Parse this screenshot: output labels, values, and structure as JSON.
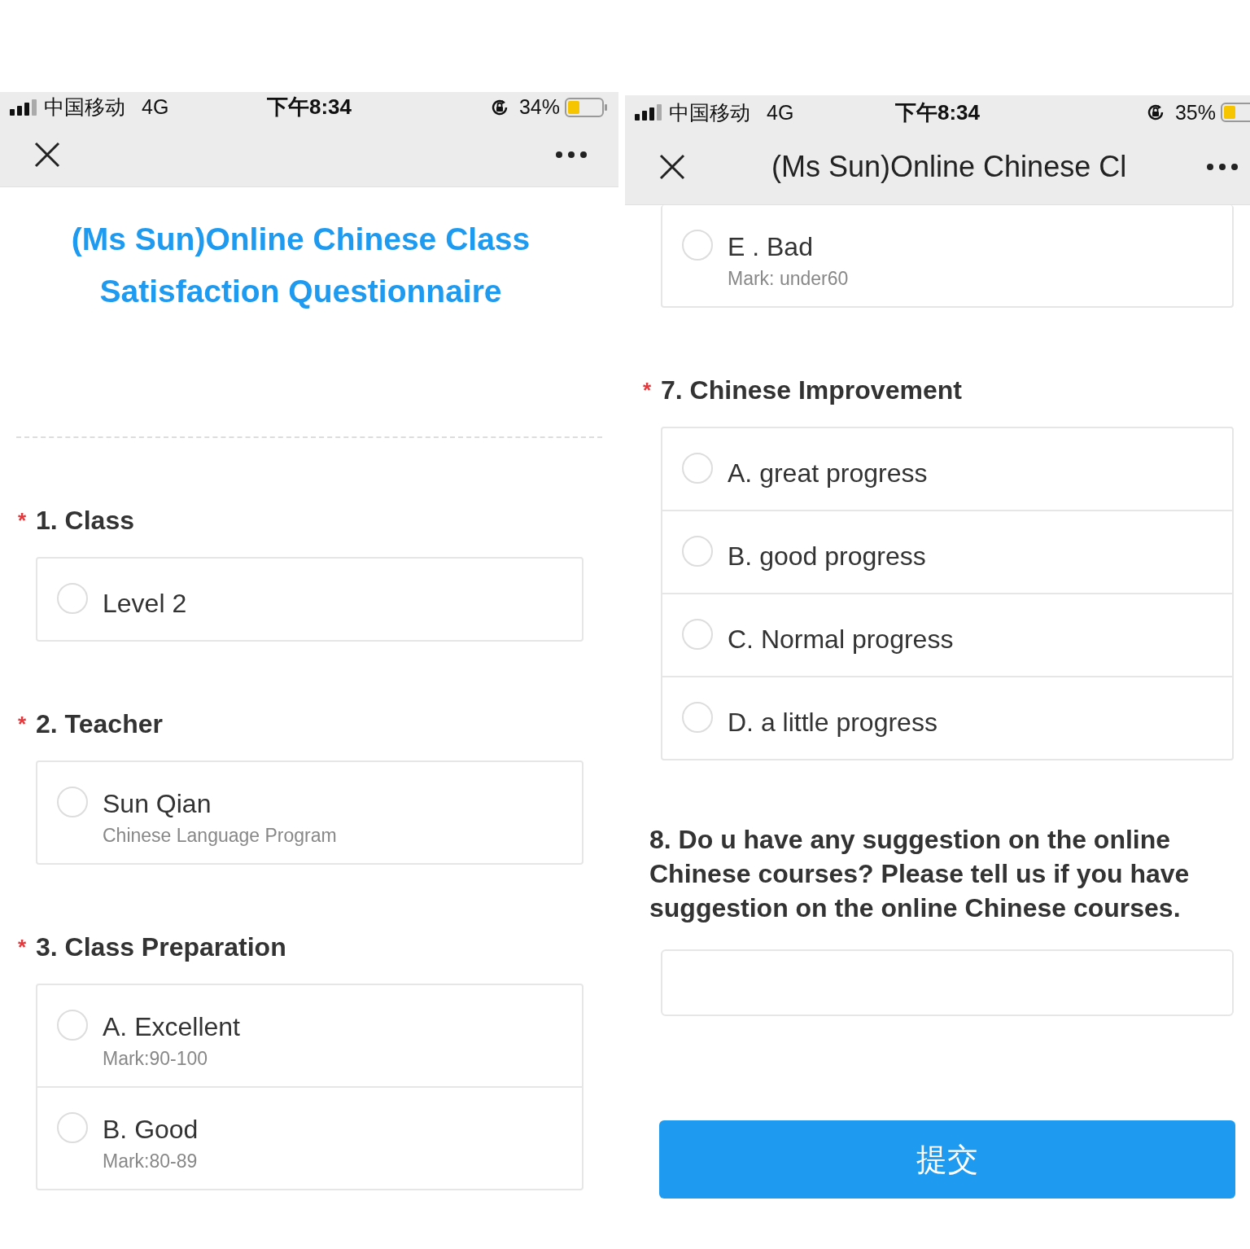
{
  "screens": [
    {
      "status": {
        "carrier": "中国移动",
        "network": "4G",
        "time": "下午8:34",
        "battery": "34%"
      },
      "page_title": [
        "(Ms Sun)Online Chinese Class",
        "Satisfaction Questionnaire"
      ],
      "questions": [
        {
          "kind": "choice",
          "marker": "*",
          "title": "1. Class",
          "options": [
            {
              "label": "Level 2",
              "selected": false
            }
          ]
        },
        {
          "kind": "choice",
          "marker": "*",
          "title": "2. Teacher",
          "options": [
            {
              "label": "Sun Qian",
              "note": "Chinese Language Program",
              "selected": false
            }
          ]
        },
        {
          "kind": "choice",
          "marker": "*",
          "title": "3. Class Preparation",
          "options": [
            {
              "label": "A. Excellent",
              "note": "Mark:90-100",
              "selected": false
            },
            {
              "label": "B. Good",
              "note": "Mark:80-89",
              "selected": false
            }
          ]
        }
      ]
    },
    {
      "status": {
        "carrier": "中国移动",
        "network": "4G",
        "time": "下午8:34",
        "battery": "35%"
      },
      "nav": {
        "title": "(Ms Sun)Online Chinese Cl"
      },
      "questions": [
        {
          "kind": "choice",
          "options": [
            {
              "label": "E . Bad",
              "note": "Mark: under60",
              "selected": false
            }
          ]
        },
        {
          "kind": "choice",
          "marker": "*",
          "title": "7. Chinese Improvement",
          "options": [
            {
              "label": "A. great progress",
              "selected": false
            },
            {
              "label": "B. good progress",
              "selected": false
            },
            {
              "label": "C. Normal progress",
              "selected": false
            },
            {
              "label": "D. a little progress",
              "selected": false
            }
          ]
        },
        {
          "kind": "text",
          "title": "8. Do u have any suggestion on the online Chinese courses? Please tell us if you have suggestion on the online Chinese courses."
        }
      ],
      "submit": "提交"
    }
  ]
}
